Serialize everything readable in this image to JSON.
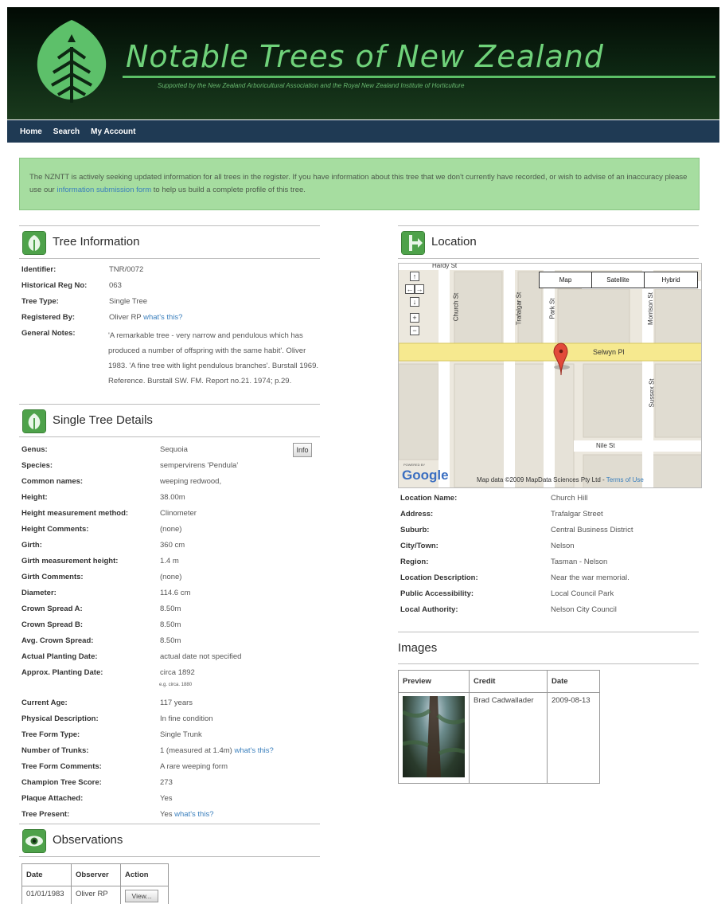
{
  "header": {
    "title": "Notable Trees of New Zealand",
    "subtitle": "Supported by the New Zealand Arboricultural Association and the Royal New Zealand Institute of Horticulture",
    "logo_icon": "tree-leaf-logo"
  },
  "nav": {
    "items": [
      "Home",
      "Search",
      "My Account"
    ]
  },
  "notice": {
    "text_before": "The NZNTT is actively seeking updated information for all trees in the register. If you have information about this tree that we don't currently have recorded, or wish to advise of an inaccuracy please use our ",
    "link": "information submission form",
    "text_after": " to help us build a complete profile of this tree."
  },
  "tree_information": {
    "heading": "Tree Information",
    "rows": [
      {
        "label": "Identifier:",
        "value": "TNR/0072"
      },
      {
        "label": "Historical Reg No:",
        "value": "063"
      },
      {
        "label": "Tree Type:",
        "value": "Single Tree"
      },
      {
        "label": "Registered By:",
        "value": "Oliver RP",
        "link": "what's this?"
      },
      {
        "label": "General Notes:",
        "value": "'A remarkable tree - very narrow and pendulous which has produced a number of offspring with the same habit'. Oliver 1983. 'A fine tree with light pendulous branches'. Burstall 1969. Reference. Burstall SW. FM. Report no.21. 1974; p.29."
      }
    ]
  },
  "single_tree_details": {
    "heading": "Single Tree Details",
    "info_button": "Info",
    "planting_hint": "e.g. circa. 1880",
    "rows": [
      {
        "label": "Genus:",
        "value": "Sequoia"
      },
      {
        "label": "Species:",
        "value": "sempervirens 'Pendula'"
      },
      {
        "label": "Common names:",
        "value": "weeping redwood,"
      },
      {
        "label": "Height:",
        "value": "38.00m"
      },
      {
        "label": "Height measurement method:",
        "value": "Clinometer"
      },
      {
        "label": "Height Comments:",
        "value": "(none)"
      },
      {
        "label": "Girth:",
        "value": "360 cm"
      },
      {
        "label": "Girth measurement height:",
        "value": "1.4 m"
      },
      {
        "label": "Girth Comments:",
        "value": "(none)"
      },
      {
        "label": "Diameter:",
        "value": "114.6 cm"
      },
      {
        "label": "Crown Spread A:",
        "value": "8.50m"
      },
      {
        "label": "Crown Spread B:",
        "value": "8.50m"
      },
      {
        "label": "Avg. Crown Spread:",
        "value": "8.50m"
      },
      {
        "label": "Actual Planting Date:",
        "value": "actual date not specified"
      },
      {
        "label": "Approx. Planting Date:",
        "value": "circa 1892"
      },
      {
        "label": "Current Age:",
        "value": "117 years"
      },
      {
        "label": "Physical Description:",
        "value": "In fine condition"
      },
      {
        "label": "Tree Form Type:",
        "value": "Single Trunk"
      },
      {
        "label": "Number of Trunks:",
        "value": "1 (measured at 1.4m)",
        "link": "what's this?"
      },
      {
        "label": "Tree Form Comments:",
        "value": "A rare weeping form"
      },
      {
        "label": "Champion Tree Score:",
        "value": "273"
      },
      {
        "label": "Plaque Attached:",
        "value": "Yes"
      },
      {
        "label": "Tree Present:",
        "value": "Yes",
        "link": "what's this?"
      }
    ]
  },
  "observations": {
    "heading": "Observations",
    "columns": [
      "Date",
      "Observer",
      "Action"
    ],
    "rows": [
      {
        "date": "01/01/1983",
        "observer": "Oliver RP",
        "action": "View..."
      }
    ]
  },
  "location": {
    "heading": "Location",
    "map": {
      "types": [
        "Map",
        "Satellite",
        "Hybrid"
      ],
      "streets": [
        "Hardy St",
        "Church St",
        "Trafalgar St",
        "Park St",
        "Morrison St",
        "Selwyn Pl",
        "Sussex St",
        "Nile St"
      ],
      "powered_by": "POWERED BY",
      "google": "Google",
      "attribution": "Map data ©2009 MapData Sciences Pty Ltd - ",
      "terms": "Terms of Use"
    },
    "rows": [
      {
        "label": "Location Name:",
        "value": "Church Hill"
      },
      {
        "label": "Address:",
        "value": "Trafalgar Street"
      },
      {
        "label": "Suburb:",
        "value": "Central Business District"
      },
      {
        "label": "City/Town:",
        "value": "Nelson"
      },
      {
        "label": "Region:",
        "value": "Tasman - Nelson"
      },
      {
        "label": "Location Description:",
        "value": "Near the war memorial."
      },
      {
        "label": "Public Accessibility:",
        "value": "Local Council Park"
      },
      {
        "label": "Local Authority:",
        "value": "Nelson City Council"
      }
    ]
  },
  "images": {
    "heading": "Images",
    "columns": [
      "Preview",
      "Credit",
      "Date"
    ],
    "rows": [
      {
        "credit": "Brad Cadwallader",
        "date": "2009-08-13"
      }
    ]
  },
  "colors": {
    "brand_green": "#4ea24a",
    "nav_blue": "#1f3a54",
    "notice_green": "#a6dda0",
    "link_blue": "#3a7fbd"
  }
}
